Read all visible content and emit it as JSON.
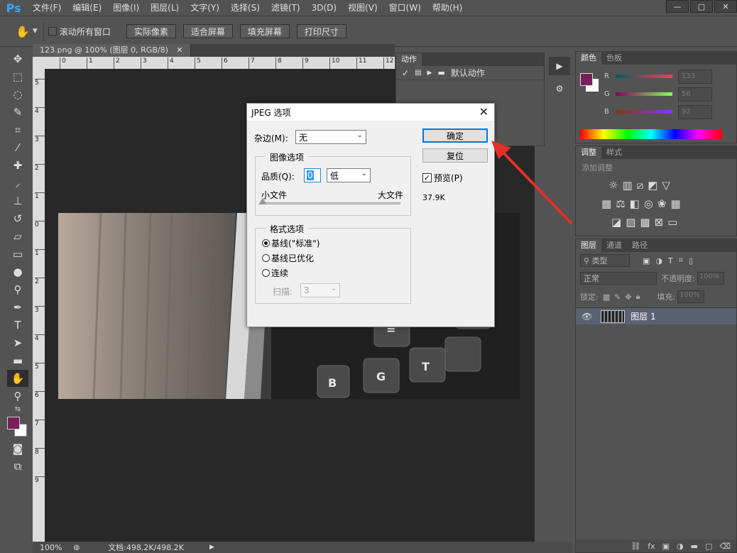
{
  "app": {
    "logo": "Ps"
  },
  "menu": [
    "文件(F)",
    "编辑(E)",
    "图像(I)",
    "图层(L)",
    "文字(Y)",
    "选择(S)",
    "滤镜(T)",
    "3D(D)",
    "视图(V)",
    "窗口(W)",
    "帮助(H)"
  ],
  "window_controls": [
    "—",
    "▢",
    "✕"
  ],
  "options_bar": {
    "scroll_all_label": "滚动所有窗口",
    "buttons": [
      "实际像素",
      "适合屏幕",
      "填充屏幕",
      "打印尺寸"
    ]
  },
  "document": {
    "tab_title": "123.png @ 100% (图层 0, RGB/8)",
    "tab_close": "✕",
    "ruler_h": [
      "0",
      "1",
      "2",
      "3",
      "4",
      "5",
      "6",
      "7",
      "8",
      "9",
      "10",
      "11",
      "12"
    ],
    "ruler_v": [
      "5",
      "4",
      "3",
      "2",
      "1",
      "0",
      "1",
      "2",
      "3",
      "4",
      "5",
      "6",
      "7",
      "8",
      "9"
    ],
    "photo_keys": [
      "=",
      "\\",
      "G",
      "T",
      "B"
    ]
  },
  "status": {
    "zoom": "100%",
    "doc_info": "文档:498.2K/498.2K"
  },
  "actions_panel": {
    "tab": "动作",
    "item": "默认动作"
  },
  "color_panel": {
    "tabs": [
      "颜色",
      "色板"
    ],
    "channels": [
      {
        "label": "R",
        "value": "133"
      },
      {
        "label": "G",
        "value": "56"
      },
      {
        "label": "B",
        "value": "92"
      }
    ],
    "fg_color": "#7a1f5c"
  },
  "adjust_panel": {
    "tabs": [
      "调整",
      "样式"
    ],
    "title": "添加调整"
  },
  "layers_panel": {
    "tabs": [
      "图层",
      "通道",
      "路径"
    ],
    "filter": "类型",
    "blend_mode": "正常",
    "opacity_label": "不透明度:",
    "opacity_value": "100%",
    "lock_label": "锁定:",
    "fill_label": "填充:",
    "fill_value": "100%",
    "layer_name": "图层 1"
  },
  "dialog": {
    "title": "JPEG 选项",
    "matte_label": "杂边(M):",
    "matte_value": "无",
    "image_options_title": "图像选项",
    "quality_label": "品质(Q):",
    "quality_value": "0",
    "quality_preset": "低",
    "small_file": "小文件",
    "large_file": "大文件",
    "quality_fraction": 0,
    "format_options_title": "格式选项",
    "format_options": [
      "基线(\"标准\")",
      "基线已优化",
      "连续"
    ],
    "selected_format": 0,
    "scans_label": "扫描:",
    "scans_value": "3",
    "ok": "确定",
    "reset": "复位",
    "preview_label": "预览(P)",
    "file_size": "37.9K"
  }
}
